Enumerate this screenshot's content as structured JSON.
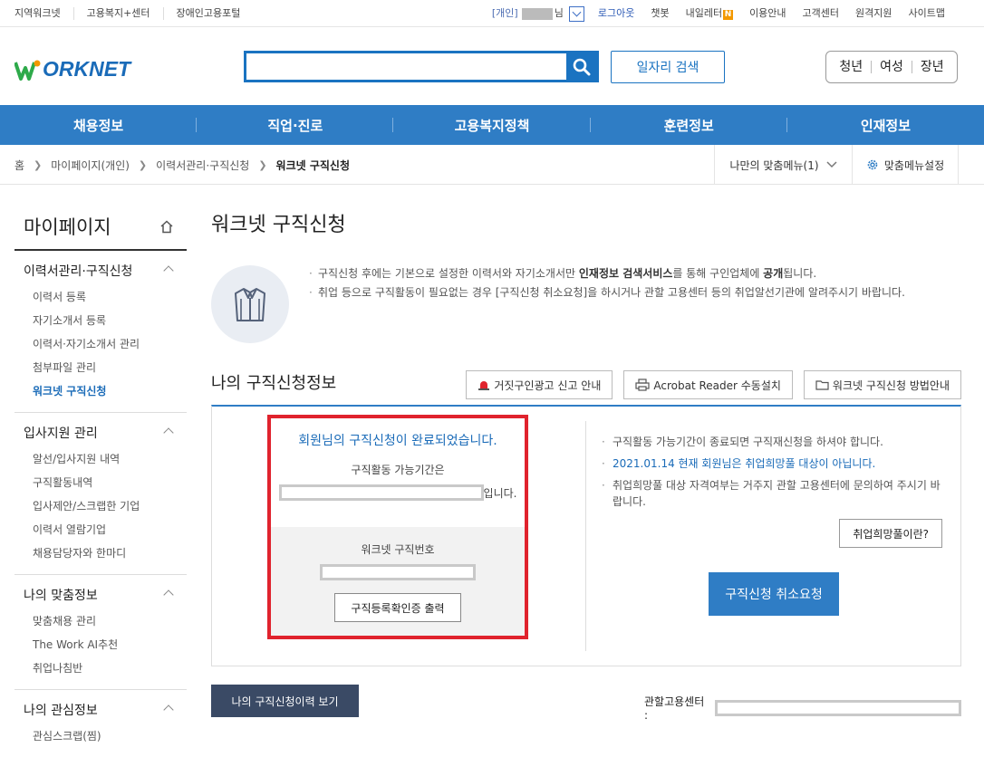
{
  "util": {
    "left_links": [
      "지역워크넷",
      "고용복지+센터",
      "장애인고용포털"
    ],
    "user_type": "[개인]",
    "user_suffix": "님",
    "logout": "로그아웃",
    "chatbot": "챗봇",
    "my_letter": "내일레터",
    "new_badge": "N",
    "guide": "이용안내",
    "customer": "고객센터",
    "remote": "원격지원",
    "sitemap": "사이트맵"
  },
  "header": {
    "logo_text": "ORKNET",
    "search_placeholder": "",
    "job_search_label": "일자리 검색",
    "audience": [
      "청년",
      "여성",
      "장년"
    ]
  },
  "gnb": [
    "채용정보",
    "직업·진로",
    "고용복지정책",
    "훈련정보",
    "인재정보"
  ],
  "breadcrumb": {
    "items": [
      "홈",
      "마이페이지(개인)",
      "이력서관리·구직신청",
      "워크넷 구직신청"
    ],
    "my_menu": "나만의 맞춤메뉴(1)",
    "menu_settings": "맞춤메뉴설정"
  },
  "sidebar": {
    "title": "마이페이지",
    "groups": [
      {
        "title": "이력서관리·구직신청",
        "items": [
          "이력서 등록",
          "자기소개서 등록",
          "이력서·자기소개서 관리",
          "첨부파일 관리",
          "워크넷 구직신청"
        ]
      },
      {
        "title": "입사지원 관리",
        "items": [
          "알선/입사지원 내역",
          "구직활동내역",
          "입사제안/스크랩한 기업",
          "이력서 열람기업",
          "채용담당자와 한마디"
        ]
      },
      {
        "title": "나의 맞춤정보",
        "items": [
          "맞춤채용 관리",
          "The Work AI추천",
          "취업나침반"
        ]
      },
      {
        "title": "나의 관심정보",
        "items": [
          "관심스크랩(찜)"
        ]
      }
    ]
  },
  "main": {
    "title": "워크넷 구직신청",
    "intro_1a": "구직신청 후에는 기본으로 설정한 이력서와 자기소개서만 ",
    "intro_1b": "인재정보 검색서비스",
    "intro_1c": "를 통해 구인업체에 ",
    "intro_1d": "공개",
    "intro_1e": "됩니다.",
    "intro_2": "취업 등으로 구직활동이 필요없는 경우 [구직신청 취소요청]을 하시거나 관할 고용센터 등의 취업알선기관에 알려주시기 바랍니다.",
    "section_title": "나의 구직신청정보",
    "btn_fake_ad": "거짓구인광고 신고 안내",
    "btn_acrobat": "Acrobat Reader 수동설치",
    "btn_howto": "워크넷 구직신청 방법안내",
    "done_message": "회원님의 구직신청이 완료되었습니다.",
    "period_label": "구직활동 가능기간은",
    "period_suffix": "입니다.",
    "number_label": "워크넷 구직번호",
    "print_btn": "구직등록확인증 출력",
    "note_1": "구직활동 가능기간이 종료되면 구직재신청을 하셔야 합니다.",
    "note_2a": "2021.01.14 현재 회원님은 ",
    "note_2b": "취업희망풀 대상이 아닙니다.",
    "note_3": "취업희망풀 대상 자격여부는 거주지 관할 고용센터에 문의하여 주시기 바랍니다.",
    "hope_btn": "취업희망풀이란?",
    "cancel_btn": "구직신청 취소요청",
    "history_btn": "나의 구직신청이력 보기",
    "center_label": "관할고용센터 :"
  },
  "colors": {
    "primary": "#2f7dc5",
    "highlight_border": "#e0232d",
    "dark_button": "#3a4a65",
    "badge": "#f39800"
  }
}
